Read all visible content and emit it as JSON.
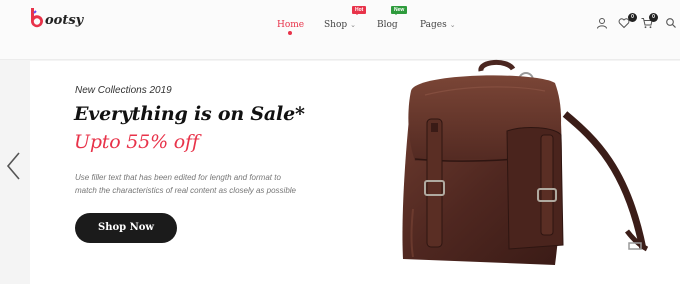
{
  "brand": {
    "name": "ootsy",
    "accent": "#e8334a",
    "accent_secondary": "#6a4cf0"
  },
  "nav": {
    "items": [
      {
        "label": "Home",
        "active": true
      },
      {
        "label": "Shop",
        "has_dropdown": true,
        "badge": "Hot"
      },
      {
        "label": "Blog",
        "badge": "New"
      },
      {
        "label": "Pages",
        "has_dropdown": true
      }
    ]
  },
  "header_icons": {
    "user": "user-icon",
    "wishlist": "heart-icon",
    "wishlist_count": "0",
    "cart": "cart-icon",
    "cart_count": "0",
    "search": "search-icon"
  },
  "hero": {
    "eyebrow": "New Collections 2019",
    "headline": "Everything is on Sale*",
    "subhead": "Upto 55% off",
    "description_line1": "Use filler text that has been edited for length and format to",
    "description_line2": "match the characteristics of real content as closely as possible",
    "cta_label": "Shop Now",
    "prev_icon": "chevron-left-icon",
    "image": "brown-leather-backpack"
  }
}
